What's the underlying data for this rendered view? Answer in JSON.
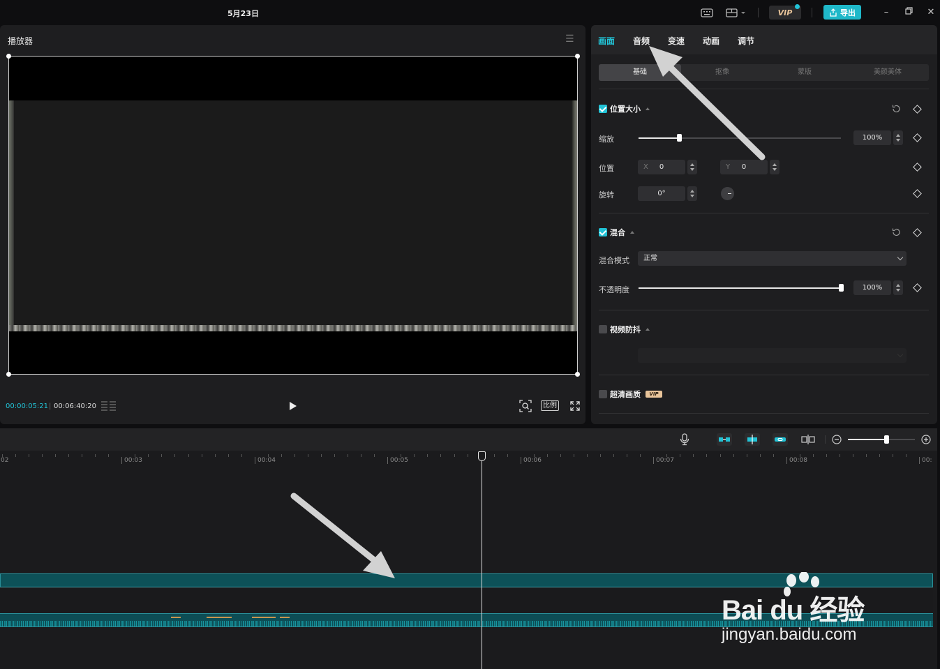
{
  "window": {
    "title": "5月23日",
    "vip_label": "VIP",
    "export_label": "导出"
  },
  "player": {
    "title": "播放器",
    "current_time": "00:00:05:21",
    "total_time": "00:06:40:20",
    "ratio_label": "比例"
  },
  "props": {
    "tabs": [
      "画面",
      "音频",
      "变速",
      "动画",
      "调节"
    ],
    "active_tab": "画面",
    "subtabs": [
      "基础",
      "抠像",
      "蒙版",
      "美颜美体"
    ],
    "sections": {
      "transform": {
        "title": "位置大小",
        "scale_label": "缩放",
        "scale_value": "100%",
        "scale_fraction": 0.2,
        "position_label": "位置",
        "x_axis": "X",
        "x_value": "0",
        "y_axis": "Y",
        "y_value": "0",
        "rotate_label": "旋转",
        "rotate_value": "0°"
      },
      "blend": {
        "title": "混合",
        "mode_label": "混合模式",
        "mode_value": "正常",
        "opacity_label": "不透明度",
        "opacity_value": "100%",
        "opacity_fraction": 1.0
      },
      "stabilize": {
        "title": "视频防抖"
      },
      "hd": {
        "title": "超清画质",
        "badge": "VIP"
      }
    }
  },
  "timeline": {
    "ruler_labels": [
      "02",
      "00:03",
      "00:04",
      "00:05",
      "00:06",
      "00:07",
      "00:08",
      "00:"
    ]
  },
  "watermark": {
    "brand": "Bai du 经验",
    "url": "jingyan.baidu.com"
  },
  "colors": {
    "accent": "#22c3d6",
    "track": "#0d5158",
    "panel": "#1e1e20"
  }
}
